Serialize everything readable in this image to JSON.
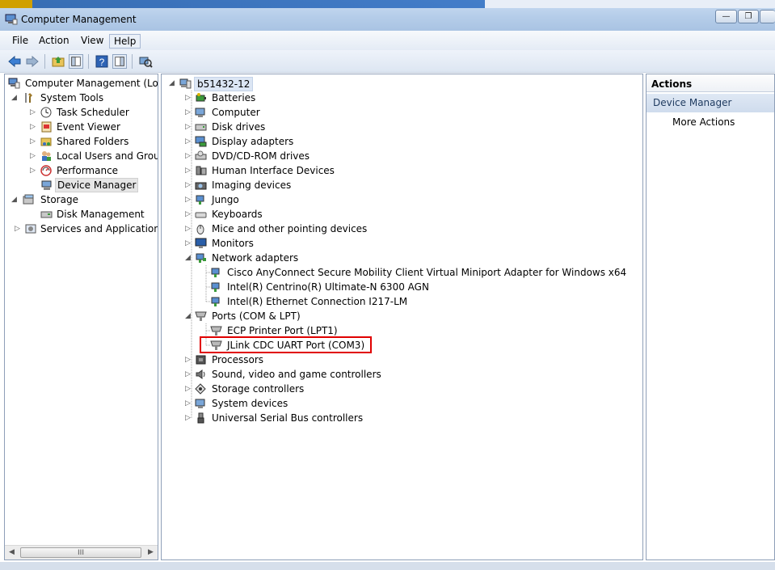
{
  "window": {
    "title": "Computer Management"
  },
  "menu": {
    "items": [
      "File",
      "Action",
      "View",
      "Help"
    ]
  },
  "left_tree": {
    "root": "Computer Management (Local",
    "system_tools": "System Tools",
    "task_scheduler": "Task Scheduler",
    "event_viewer": "Event Viewer",
    "shared_folders": "Shared Folders",
    "local_users": "Local Users and Groups",
    "performance": "Performance",
    "device_manager": "Device Manager",
    "storage": "Storage",
    "disk_management": "Disk Management",
    "services": "Services and Applications",
    "scroll_thumb": "III"
  },
  "device_tree": {
    "root": "b51432-12",
    "batteries": "Batteries",
    "computer": "Computer",
    "disk_drives": "Disk drives",
    "display_adapters": "Display adapters",
    "dvd": "DVD/CD-ROM drives",
    "hid": "Human Interface Devices",
    "imaging": "Imaging devices",
    "jungo": "Jungo",
    "keyboards": "Keyboards",
    "mice": "Mice and other pointing devices",
    "monitors": "Monitors",
    "network_adapters": "Network adapters",
    "net_children": [
      "Cisco AnyConnect Secure Mobility Client Virtual Miniport Adapter for Windows x64",
      "Intel(R) Centrino(R) Ultimate-N 6300 AGN",
      "Intel(R) Ethernet Connection I217-LM"
    ],
    "ports": "Ports (COM & LPT)",
    "port_children": [
      "ECP Printer Port (LPT1)",
      "JLink CDC UART Port (COM3)"
    ],
    "processors": "Processors",
    "sound": "Sound, video and game controllers",
    "storage_ctrl": "Storage controllers",
    "system_devices": "System devices",
    "usb": "Universal Serial Bus controllers"
  },
  "actions": {
    "header": "Actions",
    "group": "Device Manager",
    "more": "More Actions"
  },
  "colors": {
    "highlight": "#e00000",
    "title_gradient": "#b5cde9"
  }
}
